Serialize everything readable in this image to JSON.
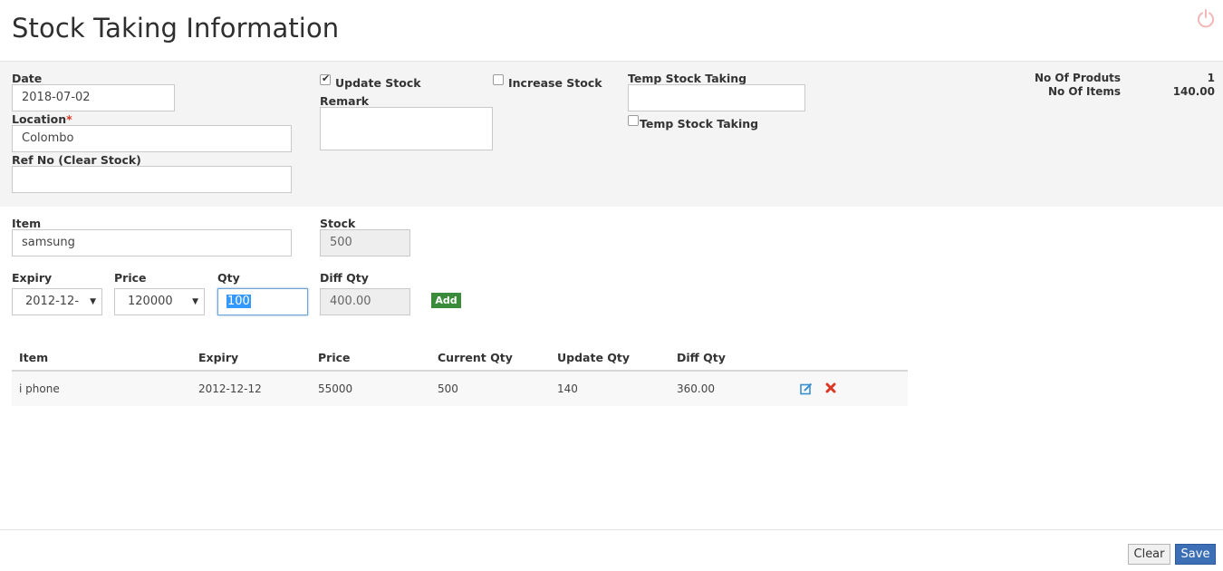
{
  "page": {
    "title": "Stock Taking Information"
  },
  "form": {
    "date_label": "Date",
    "date_value": "2018-07-02",
    "location_label": "Location",
    "location_required": "*",
    "location_value": "Colombo",
    "refno_label": "Ref No (Clear Stock)",
    "refno_value": "",
    "update_stock_label": "Update Stock",
    "update_stock_checked": true,
    "increase_stock_label": "Increase Stock",
    "increase_stock_checked": false,
    "remark_label": "Remark",
    "remark_value": "",
    "temp_stock_taking_label": "Temp Stock Taking",
    "temp_stock_taking_value": "",
    "temp_stock_taking_chk_label": "Temp Stock Taking",
    "temp_stock_taking_checked": false
  },
  "summary": {
    "products_label": "No Of Produts",
    "products_value": "1",
    "items_label": "No Of Items",
    "items_value": "140.00"
  },
  "entry": {
    "item_label": "Item",
    "item_value": "samsung",
    "stock_label": "Stock",
    "stock_value": "500",
    "expiry_label": "Expiry",
    "expiry_value": "2012-12-",
    "price_label": "Price",
    "price_value": "120000",
    "qty_label": "Qty",
    "qty_value": "100",
    "diff_label": "Diff Qty",
    "diff_value": "400.00",
    "add_label": "Add"
  },
  "grid": {
    "headers": [
      "Item",
      "Expiry",
      "Price",
      "Current Qty",
      "Update Qty",
      "Diff Qty"
    ],
    "rows": [
      {
        "item": "i phone",
        "expiry": "2012-12-12",
        "price": "55000",
        "current_qty": "500",
        "update_qty": "140",
        "diff_qty": "360.00"
      }
    ]
  },
  "footer": {
    "clear_label": "Clear",
    "save_label": "Save"
  },
  "colors": {
    "accent": "#3d6fb6",
    "add_button": "#3b8c3a",
    "delete": "#d73925",
    "edit": "#3a8fd1",
    "power": "#f2b7b7"
  },
  "icons": {
    "power": "power-icon",
    "edit": "edit-icon",
    "delete": "delete-icon"
  }
}
